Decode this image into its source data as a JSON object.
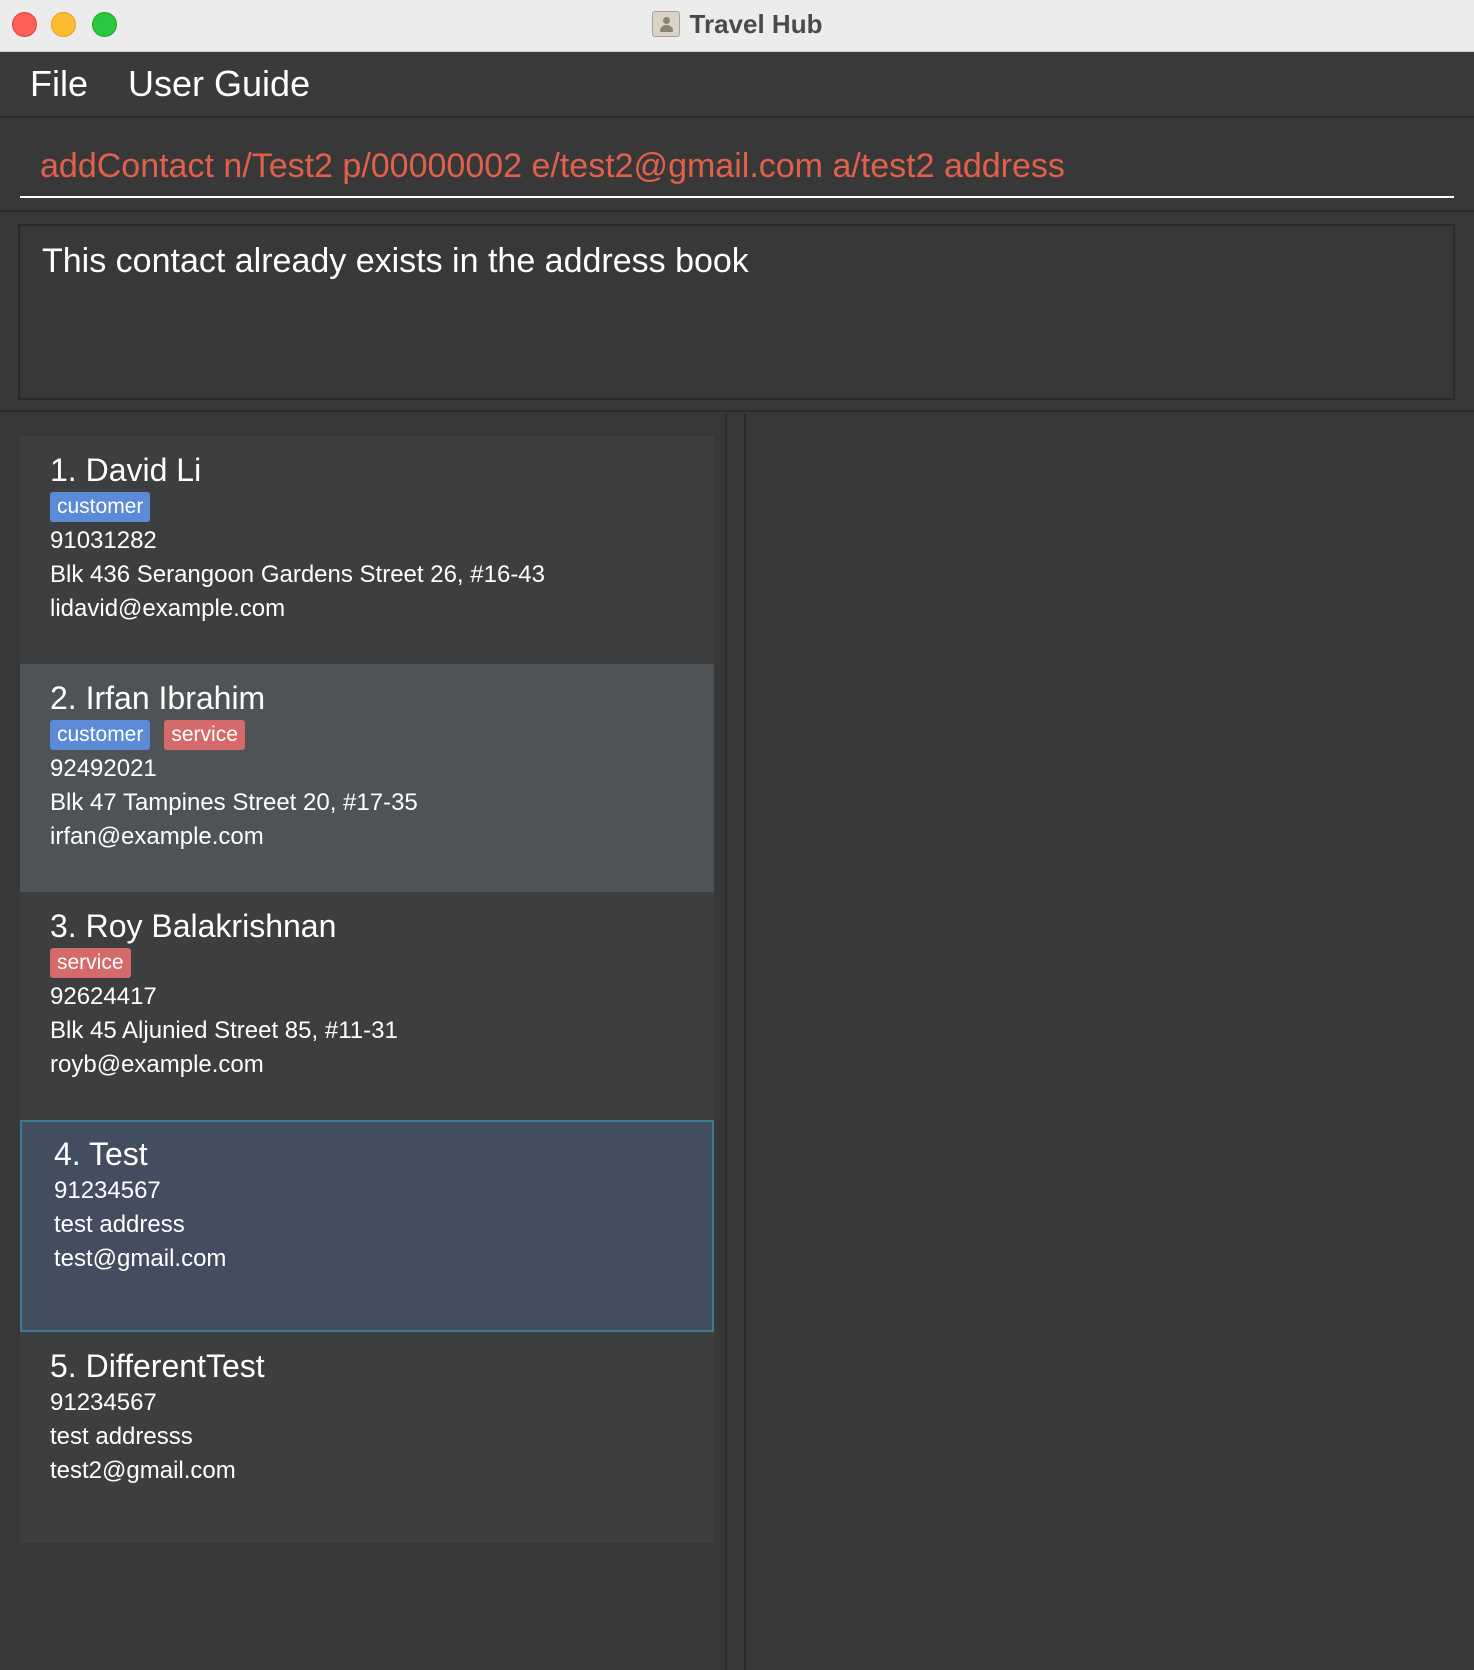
{
  "window": {
    "title": "Travel Hub"
  },
  "menu": {
    "items": [
      "File",
      "User Guide"
    ]
  },
  "command": {
    "value": "addContact n/Test2 p/00000002 e/test2@gmail.com a/test2 address"
  },
  "result": {
    "message": "This contact already exists in the address book"
  },
  "persons": [
    {
      "name": "1. David Li",
      "tags": [
        "customer"
      ],
      "phone": "91031282",
      "address": "Blk 436 Serangoon Gardens Street 26, #16-43",
      "email": "lidavid@example.com"
    },
    {
      "name": "2. Irfan Ibrahim",
      "tags": [
        "customer",
        "service"
      ],
      "phone": "92492021",
      "address": "Blk 47 Tampines Street 20, #17-35",
      "email": "irfan@example.com"
    },
    {
      "name": "3. Roy Balakrishnan",
      "tags": [
        "service"
      ],
      "phone": "92624417",
      "address": "Blk 45 Aljunied Street 85, #11-31",
      "email": "royb@example.com"
    },
    {
      "name": "4. Test",
      "tags": [],
      "phone": "91234567",
      "address": "test address",
      "email": "test@gmail.com"
    },
    {
      "name": "5. DifferentTest",
      "tags": [],
      "phone": "91234567",
      "address": "test addresss",
      "email": "test2@gmail.com"
    }
  ],
  "colors": {
    "tag_customer": "#5b8ad6",
    "tag_service": "#d46a6a",
    "command_text": "#e0604c",
    "selected_card": "#424e5f"
  }
}
